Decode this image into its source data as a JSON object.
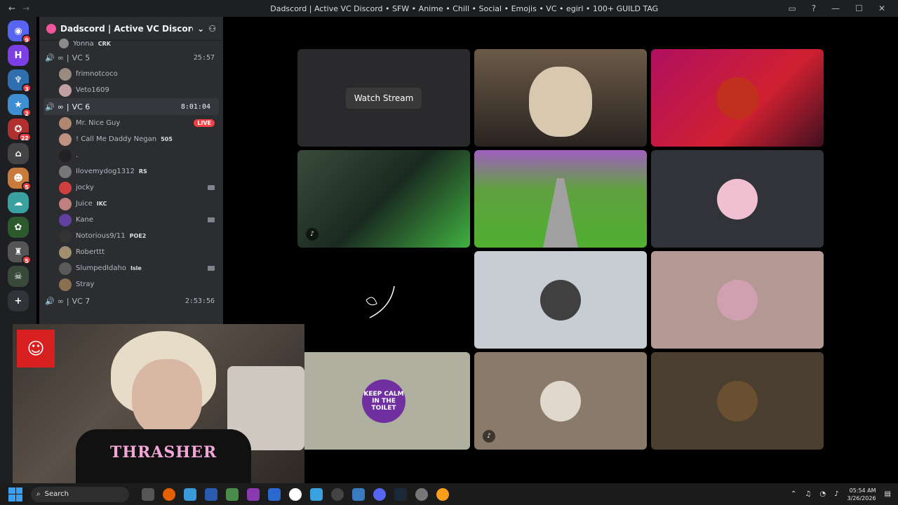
{
  "window": {
    "title": "Dadscord | Active VC Discord • SFW • Anime • Chill • Social • Emojis • VC • egirl • 100+ GUILD TAG",
    "back": "←",
    "forward": "→"
  },
  "guilds": [
    {
      "label": "◉",
      "badge": "9",
      "color": "#5865f2"
    },
    {
      "label": "H",
      "badge": "",
      "color": "#7b3fe4"
    },
    {
      "label": "♆",
      "badge": "3",
      "color": "#2f6fb0"
    },
    {
      "label": "★",
      "badge": "2",
      "color": "#3d8fd1"
    },
    {
      "label": "✪",
      "badge": "22",
      "color": "#b03030"
    },
    {
      "label": "⌂",
      "badge": "",
      "color": "#444"
    },
    {
      "label": "☻",
      "badge": "5",
      "color": "#c87b3a"
    },
    {
      "label": "☁",
      "badge": "",
      "color": "#3aa0a0"
    },
    {
      "label": "✿",
      "badge": "",
      "color": "#2d5a2d"
    },
    {
      "label": "♜",
      "badge": "5",
      "color": "#555"
    },
    {
      "label": "☠",
      "badge": "",
      "color": "#3a4a3a"
    },
    {
      "label": "+",
      "badge": "",
      "color": "#313338"
    }
  ],
  "server": {
    "name": "Dadscord | Active VC Discord • SF...",
    "top_member": "Yonna",
    "top_member_tag": "CRK"
  },
  "channels": [
    {
      "name": "VC 5",
      "timer": "25:57",
      "active": false,
      "members": [
        {
          "name": "frimnotcoco",
          "tag": "",
          "extra": "",
          "color": "#9a8a80"
        },
        {
          "name": "Veto1609",
          "tag": "",
          "extra": "",
          "color": "#c0a0a0"
        }
      ]
    },
    {
      "name": "VC 6",
      "timer": "8:01:04",
      "active": true,
      "members": [
        {
          "name": "Mr. Nice Guy",
          "tag": "",
          "extra": "LIVE",
          "color": "#b08870"
        },
        {
          "name": "! Call Me Daddy Negan",
          "tag": "505",
          "extra": "",
          "color": "#c09080"
        },
        {
          "name": ".",
          "tag": "",
          "extra": "",
          "color": "#222"
        },
        {
          "name": "Ilovemydog1312",
          "tag": "RS",
          "extra": "",
          "color": "#777"
        },
        {
          "name": "jocky",
          "tag": "",
          "extra": "cam",
          "color": "#d04040"
        },
        {
          "name": "Juice",
          "tag": "IKC",
          "extra": "",
          "color": "#c08080"
        },
        {
          "name": "Kane",
          "tag": "",
          "extra": "cam",
          "color": "#6040a0"
        },
        {
          "name": "Notorious9/11",
          "tag": "POE2",
          "extra": "",
          "color": "#333"
        },
        {
          "name": "Roberttt",
          "tag": "",
          "extra": "",
          "color": "#a09070"
        },
        {
          "name": "SlumpedIdaho",
          "tag": "Isle",
          "extra": "cam",
          "color": "#5a5a5a"
        },
        {
          "name": "Stray",
          "tag": "",
          "extra": "",
          "color": "#8a7050"
        }
      ]
    },
    {
      "name": "VC 7",
      "timer": "2:53:56",
      "active": false,
      "members": []
    }
  ],
  "stream_tiles": {
    "watch_label": "Watch Stream",
    "keep_calm": "KEEP CALM IN THE TOILET"
  },
  "webcam": {
    "shirt_text": "THRASHER"
  },
  "taskbar": {
    "search": "Search",
    "time": "05:54 AM",
    "date": "3/26/2026"
  },
  "colors": {
    "accent": "#5865f2",
    "live": "#f23f43",
    "sidebar_bg": "#2b2d31"
  }
}
